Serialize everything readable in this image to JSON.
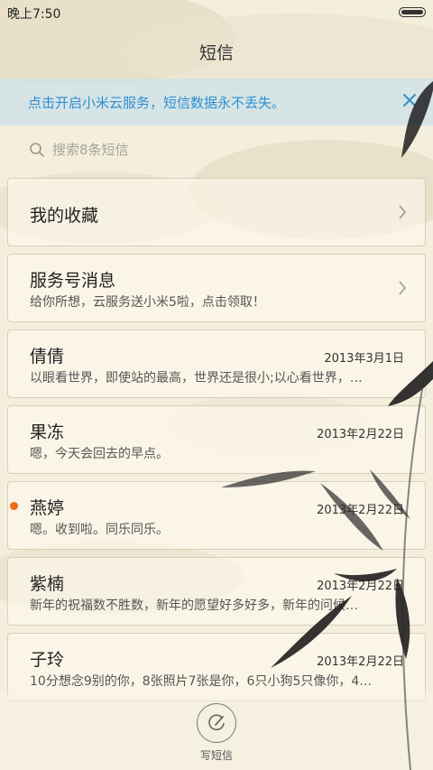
{
  "status_bar": {
    "time": "晚上7:50"
  },
  "header": {
    "title": "短信"
  },
  "banner": {
    "text": "点击开启小米云服务，短信数据永不丢失。"
  },
  "search": {
    "placeholder": "搜索8条短信"
  },
  "conversations": [
    {
      "name": "我的收藏",
      "preview": "",
      "date": "",
      "unread": false,
      "chevron": true
    },
    {
      "name": "服务号消息",
      "preview": "给你所想，云服务送小米5啦，点击领取！",
      "date": "",
      "unread": false,
      "chevron": true
    },
    {
      "name": "倩倩",
      "preview": "以眼看世界，即使站的最高，世界还是很小;以心看世界，…",
      "date": "2013年3月1日",
      "unread": false,
      "chevron": false
    },
    {
      "name": "果冻",
      "preview": "嗯，今天会回去的早点。",
      "date": "2013年2月22日",
      "unread": false,
      "chevron": false
    },
    {
      "name": "燕婷",
      "preview": "嗯。收到啦。同乐同乐。",
      "date": "2013年2月22日",
      "unread": true,
      "chevron": false
    },
    {
      "name": "紫楠",
      "preview": "新年的祝福数不胜数，新年的愿望好多好多，新年的问候…",
      "date": "2013年2月22日",
      "unread": false,
      "chevron": false
    },
    {
      "name": "子玲",
      "preview": "10分想念9别的你，8张照片7张是你，6只小狗5只像你，4…",
      "date": "2013年2月22日",
      "unread": false,
      "chevron": false
    }
  ],
  "compose": {
    "label": "写短信"
  },
  "colors": {
    "accent": "#2f8fd1",
    "unread": "#f26a1c",
    "background": "#f3ecd9"
  }
}
